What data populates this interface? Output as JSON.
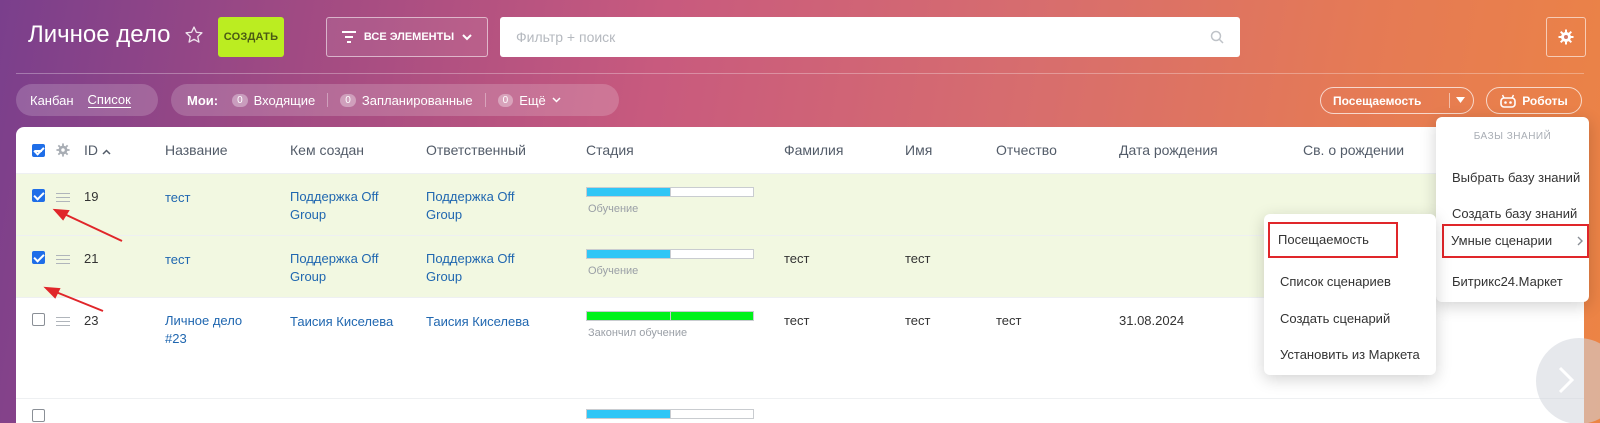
{
  "header": {
    "title": "Личное дело",
    "create_label": "СОЗДАТЬ",
    "all_items_label": "ВСЕ ЭЛЕМЕНТЫ",
    "search_placeholder": "Фильтр + поиск"
  },
  "toolbar": {
    "views": [
      "Канбан",
      "Список"
    ],
    "mine_label": "Мои:",
    "counters": [
      {
        "count": "0",
        "label": "Входящие"
      },
      {
        "count": "0",
        "label": "Запланированные"
      },
      {
        "count": "0",
        "label": "Ещё"
      }
    ],
    "visit_label": "Посещаемость",
    "robots_label": "Роботы"
  },
  "grid": {
    "columns": [
      "ID",
      "Название",
      "Кем создан",
      "Ответственный",
      "Стадия",
      "Фамилия",
      "Имя",
      "Отчество",
      "Дата рождения",
      "Св. о рождении"
    ],
    "rows": [
      {
        "checked": true,
        "id": "19",
        "name": [
          "тест"
        ],
        "created_by": [
          "Поддержка Off",
          "Group"
        ],
        "responsible": [
          "Поддержка Off",
          "Group"
        ],
        "stage": "Обучение",
        "stage_progress": 0.5,
        "stage_color": "#2fc6f6",
        "surname": "",
        "first_name": "",
        "patronymic": "",
        "birth_date": ""
      },
      {
        "checked": true,
        "id": "21",
        "name": [
          "тест"
        ],
        "created_by": [
          "Поддержка Off",
          "Group"
        ],
        "responsible": [
          "Поддержка Off",
          "Group"
        ],
        "stage": "Обучение",
        "stage_progress": 0.5,
        "stage_color": "#2fc6f6",
        "surname": "тест",
        "first_name": "тест",
        "patronymic": "",
        "birth_date": ""
      },
      {
        "checked": false,
        "id": "23",
        "name": [
          "Личное дело",
          "#23"
        ],
        "created_by": [
          "Таисия Киселева"
        ],
        "responsible": [
          "Таисия Киселева"
        ],
        "stage": "Закончил обучение",
        "stage_progress": 1.0,
        "stage_color": "#00f21a",
        "surname": "тест",
        "first_name": "тест",
        "patronymic": "тест",
        "birth_date": "31.08.2024"
      }
    ],
    "partial_row": {
      "checked": false,
      "stage_progress": 0.5,
      "stage_color": "#2fc6f6"
    }
  },
  "knowledge_menu": {
    "section_title": "БАЗЫ ЗНАНИЙ",
    "items": [
      "Выбрать базу знаний",
      "Создать базу знаний",
      "Умные сценарии",
      "Битрикс24.Маркет"
    ]
  },
  "scenario_menu": {
    "items": [
      "Посещаемость",
      "Список сценариев",
      "Создать сценарий",
      "Установить из Маркета"
    ]
  },
  "colors": {
    "accent_green": "#bbed21",
    "link_blue": "#2067b0",
    "checkbox_blue": "#1f6ee8",
    "highlight_red": "#e0262a",
    "selected_row": "#f2f8e1"
  }
}
